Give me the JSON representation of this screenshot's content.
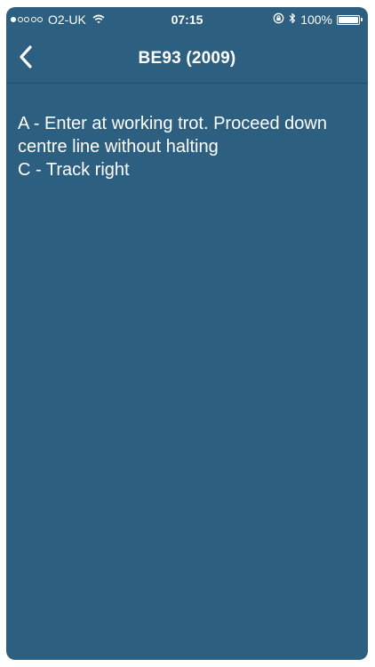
{
  "status_bar": {
    "carrier": "O2-UK",
    "time": "07:15",
    "battery": "100%",
    "signal_filled": 1,
    "signal_total": 5,
    "battery_level": 1.0
  },
  "nav": {
    "title": "BE93 (2009)",
    "back_icon": "chevron-left-icon"
  },
  "content": {
    "lines": [
      "A - Enter at working trot. Proceed down centre line without halting",
      "C - Track right"
    ]
  }
}
